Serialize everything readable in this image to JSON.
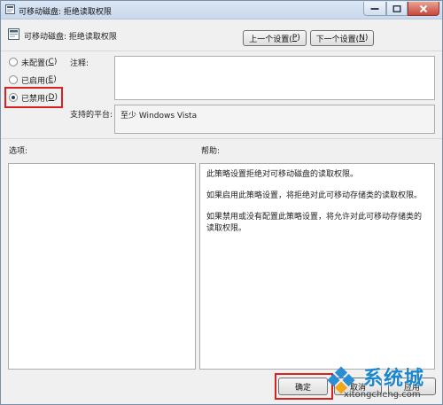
{
  "window": {
    "title": "可移动磁盘: 拒绝读取权限"
  },
  "header": {
    "setting_name": "可移动磁盘: 拒绝读取权限",
    "prev_setting": {
      "text": "上一个设置(",
      "key": "P",
      "close": ")"
    },
    "next_setting": {
      "text": "下一个设置(",
      "key": "N",
      "close": ")"
    }
  },
  "options": {
    "not_configured": {
      "text": "未配置(",
      "key": "C",
      "close": ")"
    },
    "enabled": {
      "text": "已启用(",
      "key": "E",
      "close": ")"
    },
    "disabled": {
      "text": "已禁用(",
      "key": "D",
      "close": ")"
    },
    "selected": "disabled"
  },
  "comment": {
    "label": "注释:",
    "value": ""
  },
  "platform": {
    "label": "支持的平台:",
    "value": "至少 Windows Vista"
  },
  "sections": {
    "options_label": "选项:",
    "help_label": "帮助:"
  },
  "help": {
    "paragraphs": [
      "此策略设置拒绝对可移动磁盘的读取权限。",
      "如果启用此策略设置，将拒绝对此可移动存储类的读取权限。",
      "如果禁用或没有配置此策略设置，将允许对此可移动存储类的读取权限。"
    ]
  },
  "footer": {
    "ok": "确定",
    "cancel": "取消",
    "apply": "应用"
  },
  "watermark": {
    "brand": "系统城",
    "url": "xitongcheng.com"
  },
  "colors": {
    "highlight": "#d9211f",
    "title_bar": "#c9d8ec",
    "brand_blue": "#1d86cc"
  }
}
